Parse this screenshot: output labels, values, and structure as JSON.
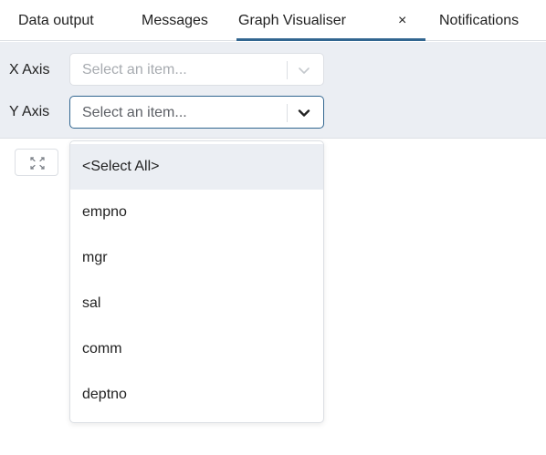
{
  "tabs": [
    {
      "label": "Data output"
    },
    {
      "label": "Messages"
    },
    {
      "label": "Graph Visualiser",
      "active": true,
      "close_glyph": "×"
    },
    {
      "label": "Notifications"
    }
  ],
  "axes": {
    "x": {
      "label": "X Axis",
      "placeholder": "Select an item..."
    },
    "y": {
      "label": "Y Axis",
      "placeholder": "Select an item...",
      "open": true
    }
  },
  "dropdown": {
    "options": [
      "<Select All>",
      "empno",
      "mgr",
      "sal",
      "comm",
      "deptno"
    ],
    "highlighted_index": 0
  },
  "toolbar": {
    "expand_icon": "expand-icon"
  },
  "colors": {
    "accent": "#326690",
    "panel_bg": "#ebeef3",
    "border": "#dcdfe4",
    "highlight": "#ebeef3"
  }
}
